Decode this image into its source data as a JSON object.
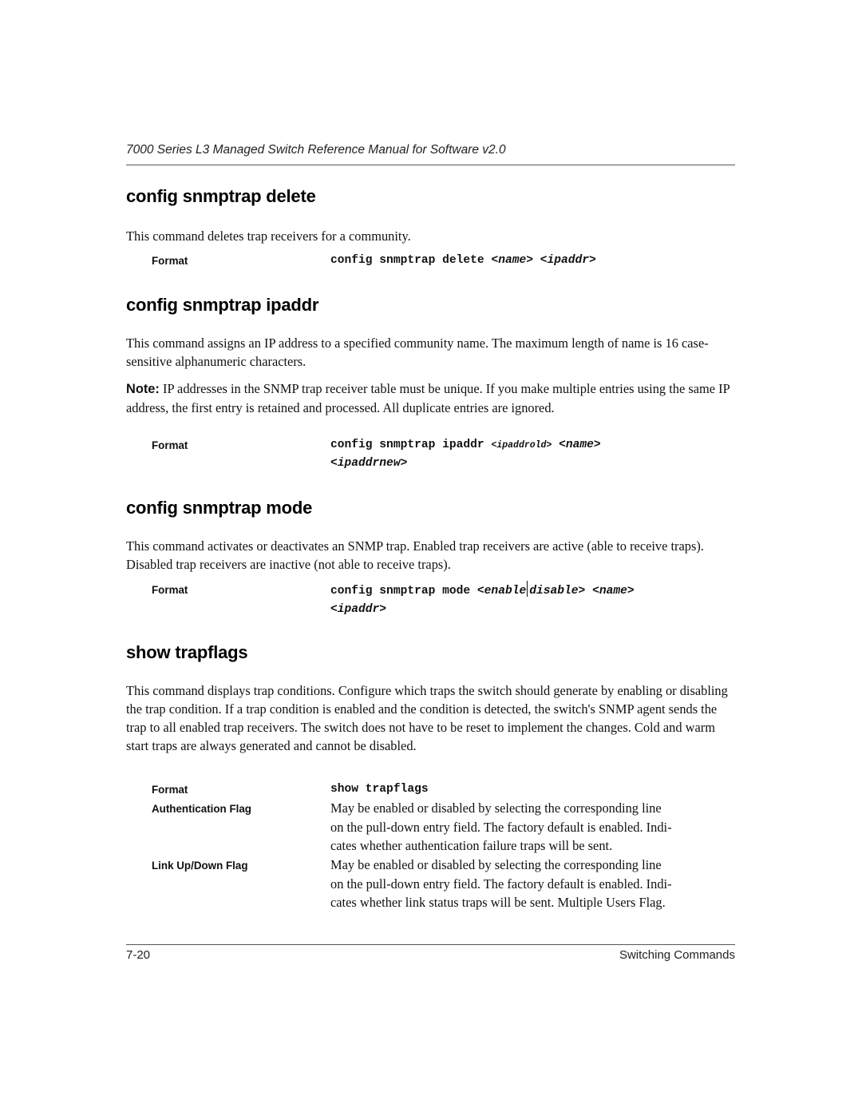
{
  "header": {
    "running_title": "7000 Series L3 Managed Switch Reference Manual for Software v2.0"
  },
  "sections": [
    {
      "heading": "config snmptrap delete",
      "description": "This command deletes trap receivers for a community.",
      "format_label": "Format",
      "format": {
        "command": "config snmptrap delete ",
        "args": [
          "<name>",
          "<ipaddr>"
        ]
      }
    },
    {
      "heading": "config snmptrap ipaddr",
      "description": "This command assigns an IP address to a specified community name. The maximum length of name is 16 case-sensitive alphanumeric characters.",
      "note_label": "Note:",
      "note_text": " IP addresses in the SNMP trap receiver table must be unique. If you make multiple entries using the same IP address, the first entry is retained and processed. All duplicate entries are ignored.",
      "format_label": "Format",
      "format": {
        "command": "config snmptrap ipaddr ",
        "args": [
          "<ipaddrold>",
          "<name>",
          "<ipaddrnew>"
        ]
      }
    },
    {
      "heading": "config snmptrap mode",
      "description": "This command activates or deactivates an SNMP trap. Enabled trap receivers are active (able to receive traps). Disabled trap receivers are inactive (not able to receive traps).",
      "format_label": "Format",
      "format": {
        "command": "config snmptrap mode ",
        "arg_enable": "<enable",
        "arg_disable": "disable>",
        "args": [
          "<name>",
          "<ipaddr>"
        ]
      }
    },
    {
      "heading": "show trapflags",
      "description": "This command displays trap conditions. Configure which traps the switch should generate by enabling or disabling the trap condition. If a trap condition is enabled and the condition is detected, the switch's SNMP agent sends the trap to all enabled trap receivers. The switch does not have to be reset to implement the changes. Cold and warm start traps are always generated and cannot be disabled.",
      "format_label": "Format",
      "format": {
        "command": "show trapflags"
      },
      "fields": [
        {
          "label": "Authentication Flag",
          "lines": [
            "May be enabled or disabled by selecting the corresponding line",
            "on the pull-down entry field. The factory default is enabled. Indi-",
            "cates whether authentication failure traps will be sent."
          ]
        },
        {
          "label": "Link Up/Down Flag",
          "lines": [
            "May be enabled or disabled by selecting the corresponding line",
            "on the pull-down entry field. The factory default is enabled. Indi-",
            "cates whether link status traps will be sent. Multiple Users Flag."
          ]
        }
      ]
    }
  ],
  "footer": {
    "page_number": "7-20",
    "chapter": "Switching Commands"
  }
}
